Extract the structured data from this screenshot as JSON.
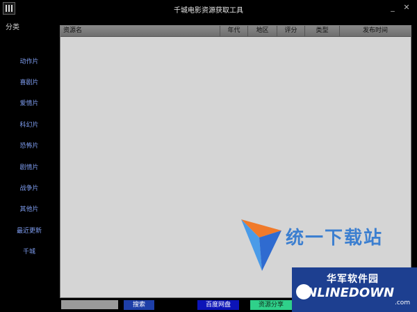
{
  "window": {
    "title": "千城电影资源获取工具",
    "minimize_glyph": "_",
    "close_glyph": "✕"
  },
  "sidebar": {
    "heading": "分类",
    "items": [
      {
        "label": "动作片"
      },
      {
        "label": "喜剧片"
      },
      {
        "label": "爱情片"
      },
      {
        "label": "科幻片"
      },
      {
        "label": "恐怖片"
      },
      {
        "label": "剧情片"
      },
      {
        "label": "战争片"
      },
      {
        "label": "其他片"
      },
      {
        "label": "最近更新"
      },
      {
        "label": "千城"
      }
    ]
  },
  "table": {
    "columns": [
      "资源名",
      "年代",
      "地区",
      "评分",
      "类型",
      "发布时间"
    ],
    "rows": []
  },
  "bottom": {
    "search_value": "",
    "search_label": "搜索",
    "baidu_label": "百度网盘",
    "share_label": "资源分享"
  },
  "watermark": {
    "brand_text": "统一下载站",
    "corner_cn": "华军软件园",
    "corner_en": "ONLINEDOWN",
    "corner_suffix": ".com"
  },
  "colors": {
    "accent_blue": "#7e9df0",
    "search_button": "#1e3fa8",
    "baidu_button": "#0c14b8",
    "share_button": "#2fd08a"
  }
}
